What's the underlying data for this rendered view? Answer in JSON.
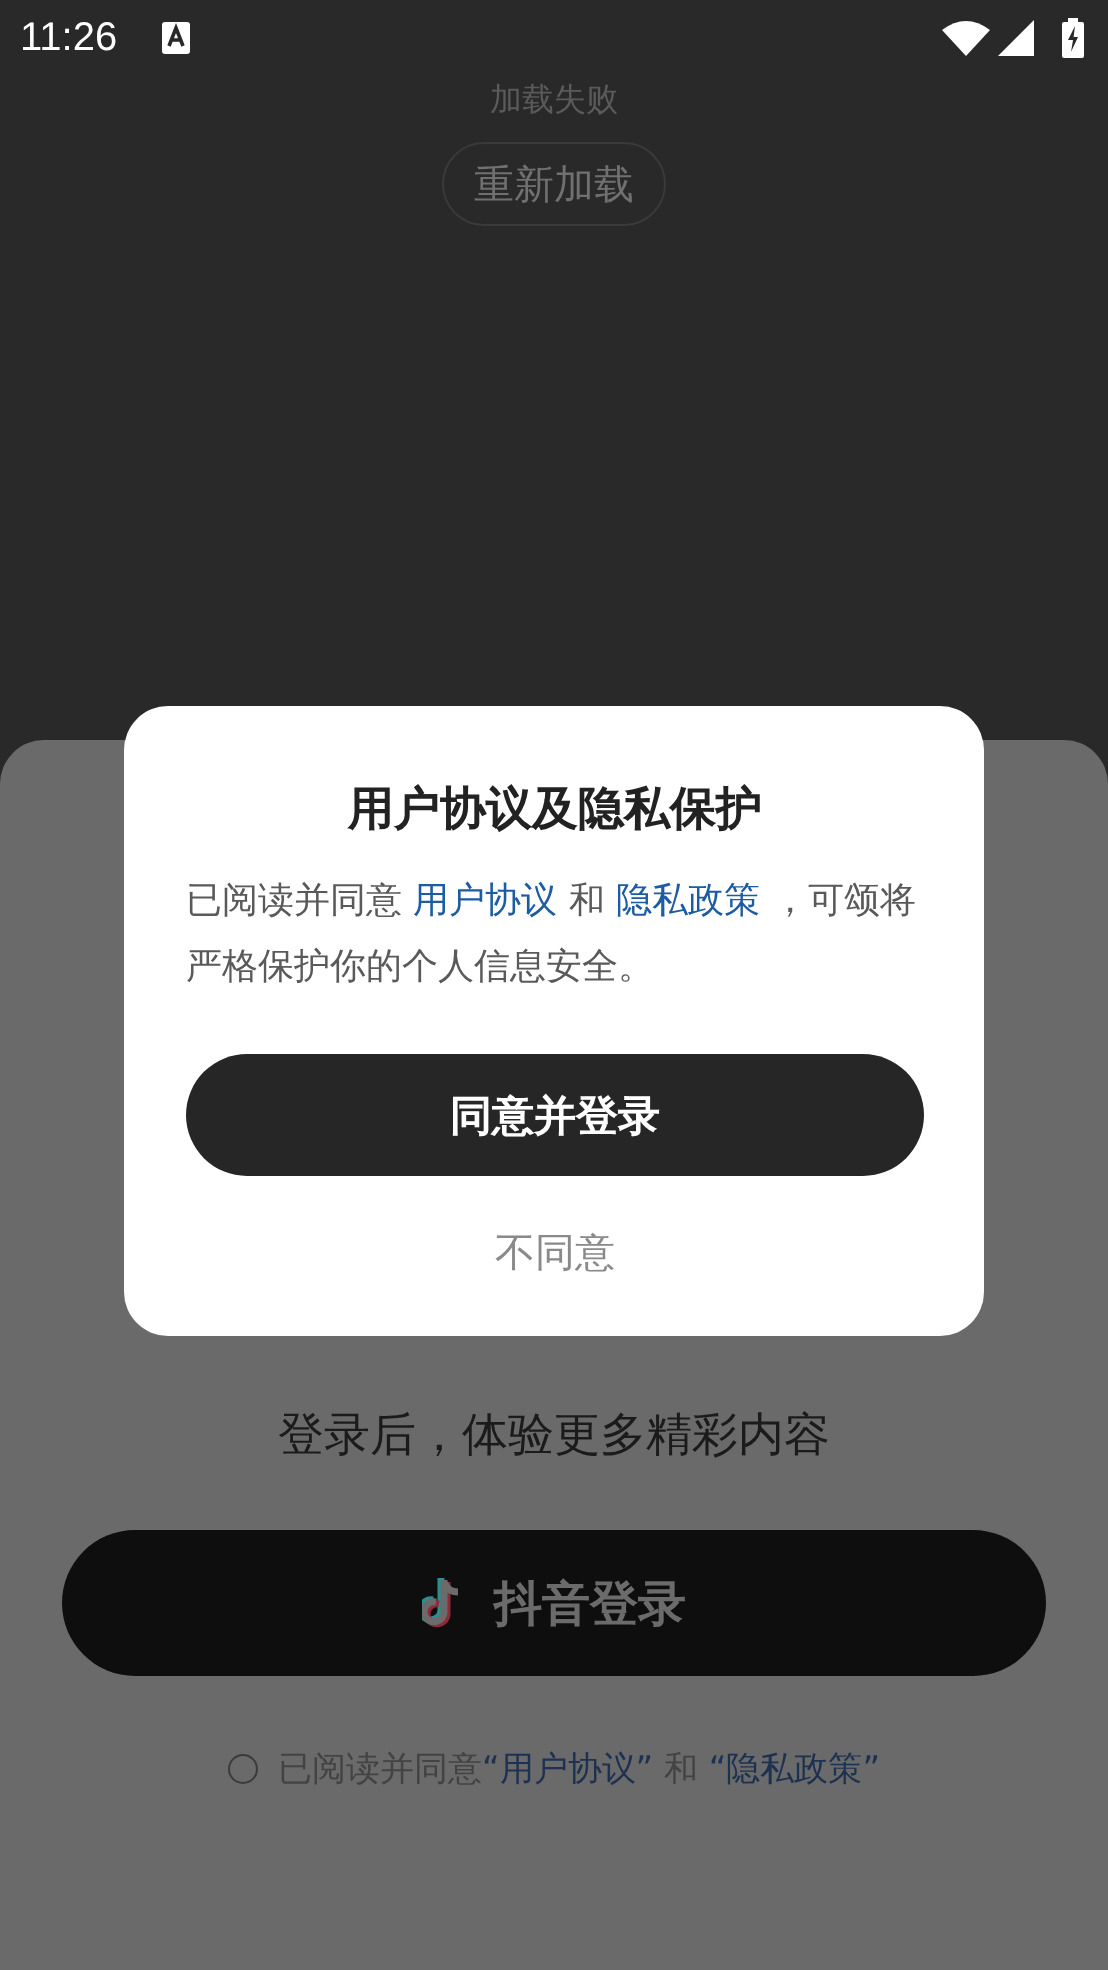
{
  "status_bar": {
    "time": "11:26"
  },
  "background_page": {
    "error_text": "加载失败",
    "reload_button": "重新加载"
  },
  "login_sheet": {
    "headline": "登录后，体验更多精彩内容",
    "login_button": "抖音登录",
    "agreement": {
      "checked": false,
      "parts": [
        {
          "kind": "plain",
          "text": "已阅读并同意"
        },
        {
          "kind": "link",
          "text": "“用户协议”"
        },
        {
          "kind": "plain",
          "text": " 和 "
        },
        {
          "kind": "link",
          "text": "“隐私政策”"
        }
      ]
    }
  },
  "dialog": {
    "title": "用户协议及隐私保护",
    "body": [
      {
        "kind": "plain",
        "text": "已阅读并同意 "
      },
      {
        "kind": "link",
        "text": "用户协议"
      },
      {
        "kind": "plain",
        "text": " 和 "
      },
      {
        "kind": "link",
        "text": "隐私政策"
      },
      {
        "kind": "plain",
        "text": " ，可颂将严格保护你的个人信息安全。"
      }
    ],
    "confirm_button": "同意并登录",
    "decline_button": "不同意"
  }
}
